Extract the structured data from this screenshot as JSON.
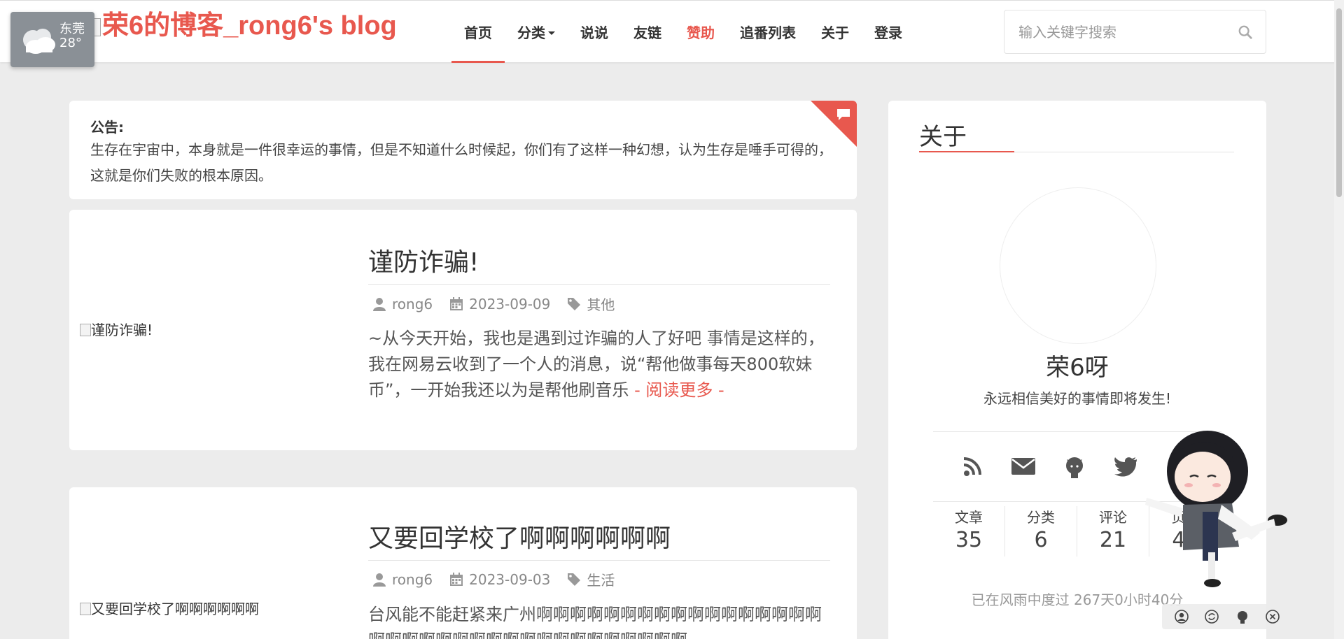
{
  "header": {
    "logo_text": "荣6的博客_rong6's blog",
    "nav": [
      "首页",
      "分类",
      "说说",
      "友链",
      "赞助",
      "追番列表",
      "关于",
      "登录"
    ],
    "search_placeholder": "输入关键字搜索"
  },
  "weather": {
    "city": "东莞",
    "temp": "28°"
  },
  "notice": {
    "title": "公告:",
    "text": "生存在宇宙中，本身就是一件很幸运的事情，但是不知道什么时候起，你们有了这样一种幻想，认为生存是唾手可得的，这就是你们失败的根本原因。"
  },
  "posts": [
    {
      "thumb_alt": "谨防诈骗!",
      "title": "谨防诈骗!",
      "author": "rong6",
      "date": "2023-09-09",
      "category": "其他",
      "excerpt": "~从今天开始，我也是遇到过诈骗的人了好吧 事情是这样的，我在网易云收到了一个人的消息，说“帮他做事每天800软妹币”，一开始我还以为是帮他刷音乐",
      "read_more": " - 阅读更多 -"
    },
    {
      "thumb_alt": "又要回学校了啊啊啊啊啊啊",
      "title": "又要回学校了啊啊啊啊啊啊",
      "author": "rong6",
      "date": "2023-09-03",
      "category": "生活",
      "excerpt": "台风能不能赶紧来广州啊啊啊啊啊啊啊啊啊啊啊啊啊啊啊啊啊啊啊啊啊啊啊啊啊啊啊啊啊啊啊啊啊啊啊啊"
    }
  ],
  "sidebar": {
    "heading": "关于",
    "name": "荣6呀",
    "motto": "永远相信美好的事情即将发生!",
    "social": [
      "rss-icon",
      "mail-icon",
      "github-icon",
      "twitter-icon"
    ],
    "stats": [
      {
        "label": "文章",
        "value": "35"
      },
      {
        "label": "分类",
        "value": "6"
      },
      {
        "label": "评论",
        "value": "21"
      },
      {
        "label": "页面",
        "value": "40"
      }
    ],
    "uptime": "已在风雨中度过 267天0小时40分"
  },
  "colors": {
    "accent": "#e8584e",
    "background": "#ececec"
  }
}
